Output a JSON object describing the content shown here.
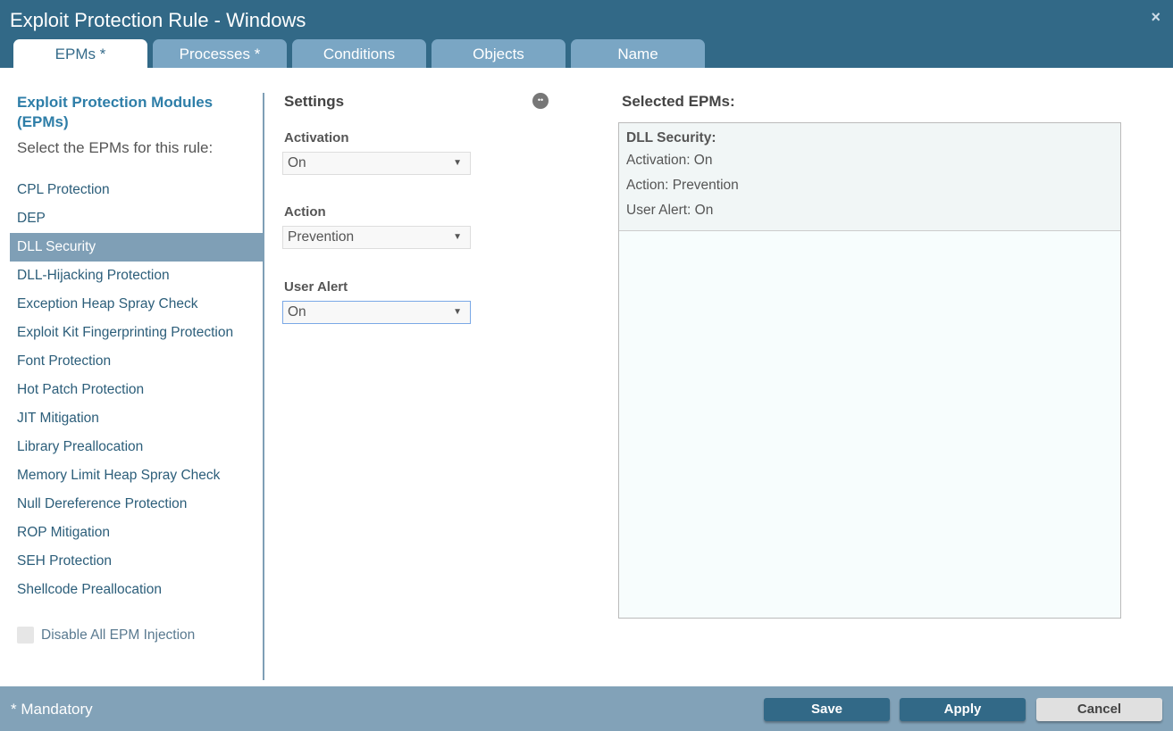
{
  "window": {
    "title": "Exploit Protection Rule - Windows",
    "close": "×"
  },
  "tabs": [
    {
      "label": "EPMs *"
    },
    {
      "label": "Processes *"
    },
    {
      "label": "Conditions"
    },
    {
      "label": "Objects"
    },
    {
      "label": "Name"
    }
  ],
  "left": {
    "heading": "Exploit Protection Modules (EPMs)",
    "subtitle": "Select the EPMs for this rule:",
    "items": [
      "CPL Protection",
      "DEP",
      "DLL Security",
      "DLL-Hijacking Protection",
      "Exception Heap Spray Check",
      "Exploit Kit Fingerprinting Protection",
      "Font Protection",
      "Hot Patch Protection",
      "JIT Mitigation",
      "Library Preallocation",
      "Memory Limit Heap Spray Check",
      "Null Dereference Protection",
      "ROP Mitigation",
      "SEH Protection",
      "Shellcode Preallocation"
    ],
    "selected_index": 2,
    "disable_label": "Disable All EPM Injection"
  },
  "settings": {
    "heading": "Settings",
    "activation_label": "Activation",
    "activation_value": "On",
    "action_label": "Action",
    "action_value": "Prevention",
    "alert_label": "User Alert",
    "alert_value": "On"
  },
  "selected": {
    "heading": "Selected EPMs:",
    "name": "DLL Security:",
    "activation": "Activation: On",
    "action": "Action: Prevention",
    "alert": "User Alert: On"
  },
  "footer": {
    "mandatory": "* Mandatory",
    "save": "Save",
    "apply": "Apply",
    "cancel": "Cancel"
  }
}
